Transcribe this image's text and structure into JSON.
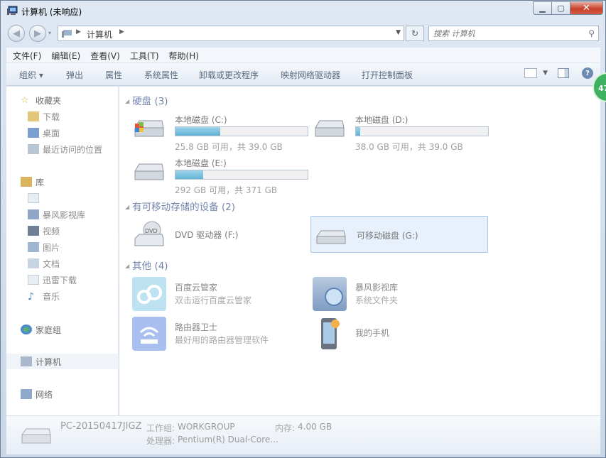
{
  "window": {
    "title": "计算机 (未响应)",
    "min_label": "▁",
    "max_label": "▢",
    "close_label": "✕"
  },
  "nav": {
    "back": "◀",
    "forward": "▶",
    "address_crumb": "计算机",
    "search_placeholder": "搜索 计算机"
  },
  "menu": [
    "文件(F)",
    "编辑(E)",
    "查看(V)",
    "工具(T)",
    "帮助(H)"
  ],
  "toolbar": {
    "organize": "组织 ▾",
    "items": [
      "弹出",
      "属性",
      "系统属性",
      "卸载或更改程序",
      "映射网络驱动器",
      "打开控制面板"
    ]
  },
  "sidebar": {
    "favorites": "收藏夹",
    "favorites_items": [
      "下载",
      "桌面",
      "最近访问的位置"
    ],
    "libraries": "库",
    "library_items": [
      "",
      "暴风影视库",
      "视频",
      "图片",
      "文档",
      "迅雷下载",
      "音乐"
    ],
    "homegroup": "家庭组",
    "computer": "计算机",
    "network": "网络"
  },
  "groups": {
    "hdd": "硬盘 (3)",
    "removable": "有可移动存储的设备 (2)",
    "other": "其他 (4)"
  },
  "drives": [
    {
      "name": "本地磁盘 (C:)",
      "info": "25.8 GB 可用，共 39.0 GB",
      "used_fraction": 0.34
    },
    {
      "name": "本地磁盘 (D:)",
      "info": "38.0 GB 可用，共 39.0 GB",
      "used_fraction": 0.03
    },
    {
      "name": "本地磁盘 (E:)",
      "info": "292 GB 可用，共 371 GB",
      "used_fraction": 0.21
    }
  ],
  "devices": [
    {
      "name": "DVD 驱动器 (F:)",
      "label": "DVD"
    },
    {
      "name": "可移动磁盘 (G:)"
    }
  ],
  "others": [
    {
      "name": "百度云管家",
      "sub": "双击运行百度云管家"
    },
    {
      "name": "暴风影视库",
      "sub": "系统文件夹"
    },
    {
      "name": "路由器卫士",
      "sub": "最好用的路由器管理软件"
    },
    {
      "name": "我的手机",
      "sub": ""
    }
  ],
  "details": {
    "pc_name": "PC-20150417JIGZ",
    "workgroup_label": "工作组:",
    "workgroup": "WORKGROUP",
    "memory_label": "内存:",
    "memory": "4.00 GB",
    "cpu_label": "处理器:",
    "cpu": "Pentium(R) Dual-Core..."
  },
  "badge": "47",
  "colors": {
    "accent": "#1d3a7c",
    "bar_fill": "#5fb4d7",
    "selection": "#e8f1fb"
  }
}
